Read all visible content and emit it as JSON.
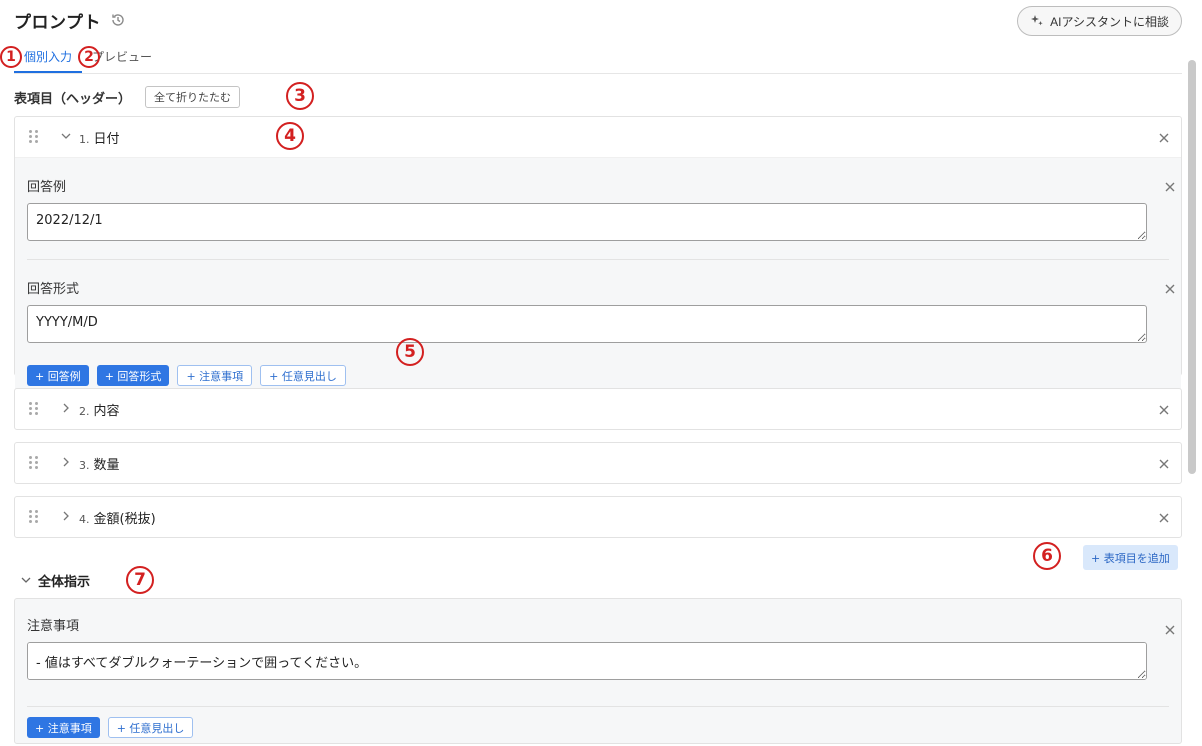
{
  "header": {
    "title": "プロンプト",
    "ai_button_label": "AIアシスタントに相談"
  },
  "tabs": [
    {
      "label": "個別入力",
      "active": true
    },
    {
      "label": "プレビュー",
      "active": false
    }
  ],
  "table_section": {
    "title": "表項目（ヘッダー）",
    "collapse_all_label": "全て折りたたむ"
  },
  "items": [
    {
      "number": "1.",
      "label": "日付",
      "expanded": true,
      "fields": [
        {
          "label": "回答例",
          "value": "2022/12/1"
        },
        {
          "label": "回答形式",
          "value": "YYYY/M/D"
        }
      ],
      "buttons": [
        {
          "label": "+ 回答例",
          "style": "primary"
        },
        {
          "label": "+ 回答形式",
          "style": "primary"
        },
        {
          "label": "+ 注意事項",
          "style": "outline"
        },
        {
          "label": "+ 任意見出し",
          "style": "outline"
        }
      ]
    },
    {
      "number": "2.",
      "label": "内容",
      "expanded": false
    },
    {
      "number": "3.",
      "label": "数量",
      "expanded": false
    },
    {
      "number": "4.",
      "label": "金額(税抜)",
      "expanded": false
    }
  ],
  "add_item_label": "+ 表項目を追加",
  "global_section": {
    "title": "全体指示",
    "field_label": "注意事項",
    "field_value": "- 値はすべてダブルクォーテーションで囲ってください。",
    "buttons": [
      {
        "label": "+ 注意事項",
        "style": "primary"
      },
      {
        "label": "+ 任意見出し",
        "style": "outline"
      }
    ]
  },
  "annotations": [
    "1",
    "2",
    "3",
    "4",
    "5",
    "6",
    "7"
  ],
  "colors": {
    "accent": "#2f76e3",
    "annotation": "#d32020"
  }
}
